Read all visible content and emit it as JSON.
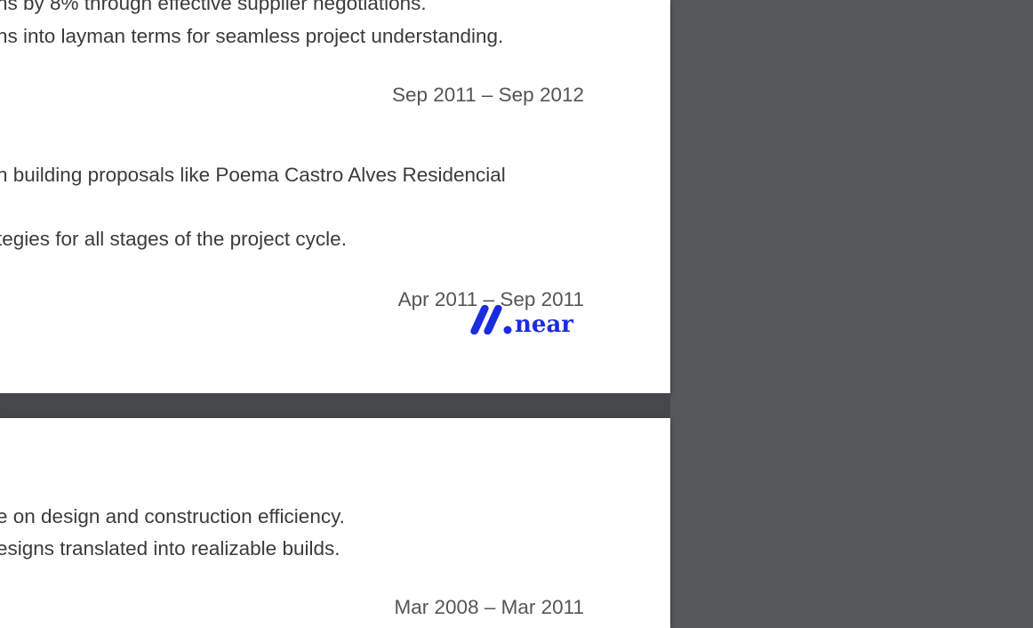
{
  "page1": {
    "line1": "ns by 8% through effective supplier negotiations.",
    "line2": "ns into layman terms for seamless project understanding.",
    "date1": "Sep 2011 – Sep 2012",
    "line3": "n building proposals like Poema Castro Alves Residencial",
    "line4": "tegies for all stages of the project cycle.",
    "date2": "Apr 2011 – Sep 2011"
  },
  "page2": {
    "line1": "e on design and construction efficiency.",
    "line2": "esigns translated into realizable builds.",
    "date1": "Mar 2008 – Mar 2011"
  },
  "watermark": {
    "text": "near",
    "color": "#1a2be0",
    "icon": "near-logo-icon"
  },
  "colors": {
    "viewer_background": "#55585b",
    "page_background": "#ffffff",
    "body_text": "#3b3b3b",
    "date_text": "#555555"
  }
}
